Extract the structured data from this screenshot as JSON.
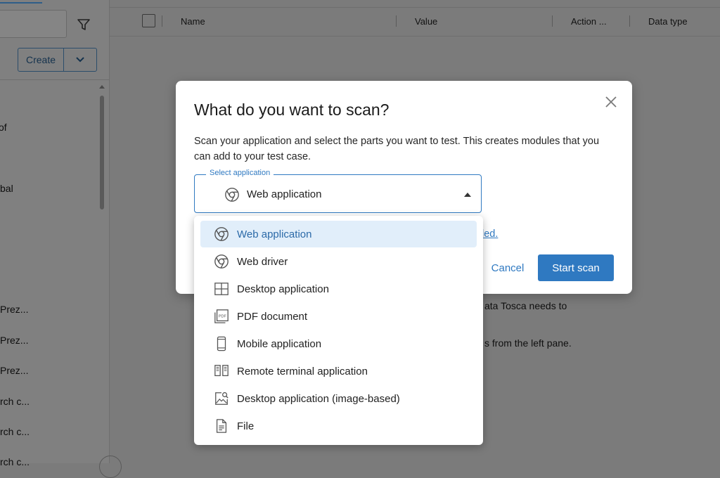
{
  "left_pane": {
    "create_label": "Create",
    "tree_items": [
      "of",
      "bal",
      "Prez...",
      "Prez...",
      "Prez...",
      "rch c...",
      "rch c...",
      "rch c..."
    ]
  },
  "table_header": {
    "columns": [
      "Name",
      "Value",
      "Action ...",
      "Data type"
    ]
  },
  "background_text": {
    "line1": "ata Tosca needs to",
    "line2": "s from the left pane."
  },
  "modal": {
    "title": "What do you want to scan?",
    "description": "Scan your application and select the parts you want to test. This creates modules that you can add to your test case.",
    "select": {
      "legend": "Select application",
      "value": "Web application",
      "icon": "chrome-icon"
    },
    "hidden_link_fragment": "led.",
    "cancel_label": "Cancel",
    "start_label": "Start scan"
  },
  "dropdown": {
    "options": [
      {
        "label": "Web application",
        "icon": "chrome-icon",
        "selected": true
      },
      {
        "label": "Web driver",
        "icon": "chrome-icon",
        "selected": false
      },
      {
        "label": "Desktop application",
        "icon": "windows-icon",
        "selected": false
      },
      {
        "label": "PDF document",
        "icon": "pdf-icon",
        "selected": false
      },
      {
        "label": "Mobile application",
        "icon": "mobile-icon",
        "selected": false
      },
      {
        "label": "Remote terminal application",
        "icon": "terminal-icon",
        "selected": false
      },
      {
        "label": "Desktop application (image-based)",
        "icon": "image-search-icon",
        "selected": false
      },
      {
        "label": "File",
        "icon": "file-icon",
        "selected": false
      }
    ]
  },
  "colors": {
    "accent": "#2f79c1",
    "selected_bg": "#e1eefa",
    "overlay": "#7b7b7b"
  }
}
